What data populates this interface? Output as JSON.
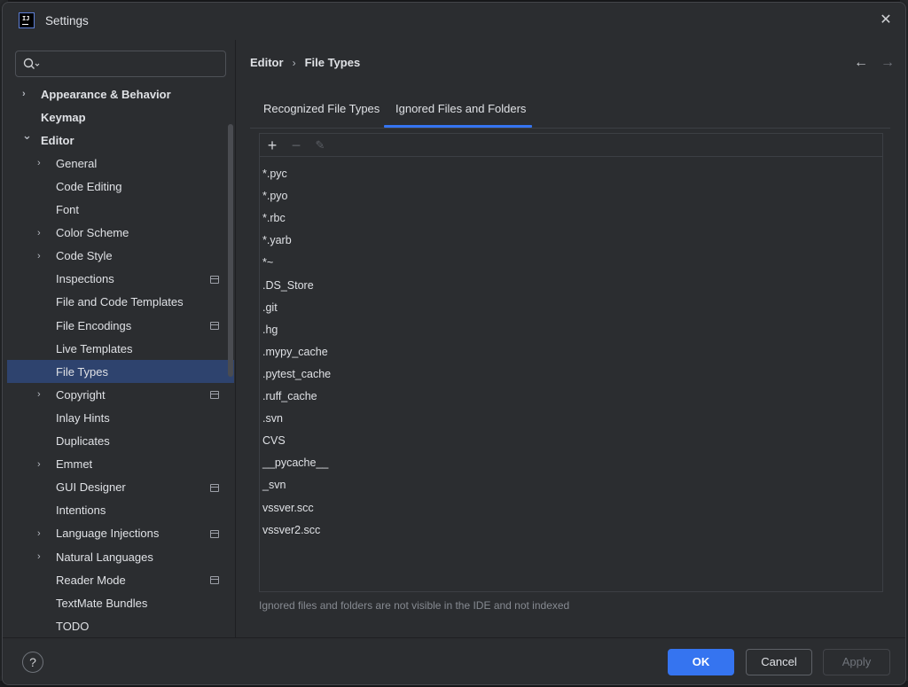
{
  "window": {
    "title": "Settings"
  },
  "search": {
    "placeholder": ""
  },
  "sidebar": {
    "items": [
      {
        "label": "Appearance & Behavior",
        "level": 0,
        "expandable": true,
        "expanded": false,
        "bold": true
      },
      {
        "label": "Keymap",
        "level": 0,
        "expandable": false,
        "bold": true
      },
      {
        "label": "Editor",
        "level": 0,
        "expandable": true,
        "expanded": true,
        "bold": true
      },
      {
        "label": "General",
        "level": 1,
        "expandable": true
      },
      {
        "label": "Code Editing",
        "level": 1,
        "expandable": false
      },
      {
        "label": "Font",
        "level": 1,
        "expandable": false
      },
      {
        "label": "Color Scheme",
        "level": 1,
        "expandable": true
      },
      {
        "label": "Code Style",
        "level": 1,
        "expandable": true
      },
      {
        "label": "Inspections",
        "level": 1,
        "expandable": false,
        "project": true
      },
      {
        "label": "File and Code Templates",
        "level": 1,
        "expandable": false
      },
      {
        "label": "File Encodings",
        "level": 1,
        "expandable": false,
        "project": true
      },
      {
        "label": "Live Templates",
        "level": 1,
        "expandable": false
      },
      {
        "label": "File Types",
        "level": 1,
        "expandable": false,
        "selected": true
      },
      {
        "label": "Copyright",
        "level": 1,
        "expandable": true,
        "project": true
      },
      {
        "label": "Inlay Hints",
        "level": 1,
        "expandable": false
      },
      {
        "label": "Duplicates",
        "level": 1,
        "expandable": false
      },
      {
        "label": "Emmet",
        "level": 1,
        "expandable": true
      },
      {
        "label": "GUI Designer",
        "level": 1,
        "expandable": false,
        "project": true
      },
      {
        "label": "Intentions",
        "level": 1,
        "expandable": false
      },
      {
        "label": "Language Injections",
        "level": 1,
        "expandable": true,
        "project": true
      },
      {
        "label": "Natural Languages",
        "level": 1,
        "expandable": true
      },
      {
        "label": "Reader Mode",
        "level": 1,
        "expandable": false,
        "project": true
      },
      {
        "label": "TextMate Bundles",
        "level": 1,
        "expandable": false
      },
      {
        "label": "TODO",
        "level": 1,
        "expandable": false
      }
    ]
  },
  "breadcrumb": {
    "parent": "Editor",
    "separator": "›",
    "current": "File Types"
  },
  "tabs": [
    {
      "label": "Recognized File Types",
      "active": false
    },
    {
      "label": "Ignored Files and Folders",
      "active": true
    }
  ],
  "ignored_entries": [
    "*.pyc",
    "*.pyo",
    "*.rbc",
    "*.yarb",
    "*~",
    ".DS_Store",
    ".git",
    ".hg",
    ".mypy_cache",
    ".pytest_cache",
    ".ruff_cache",
    ".svn",
    "CVS",
    "__pycache__",
    "_svn",
    "vssver.scc",
    "vssver2.scc"
  ],
  "hint": "Ignored files and folders are not visible in the IDE and not indexed",
  "footer": {
    "ok": "OK",
    "cancel": "Cancel",
    "apply": "Apply",
    "help": "?"
  },
  "colors": {
    "accent": "#3574f0",
    "selection": "#2e436e",
    "background": "#2b2d30"
  }
}
